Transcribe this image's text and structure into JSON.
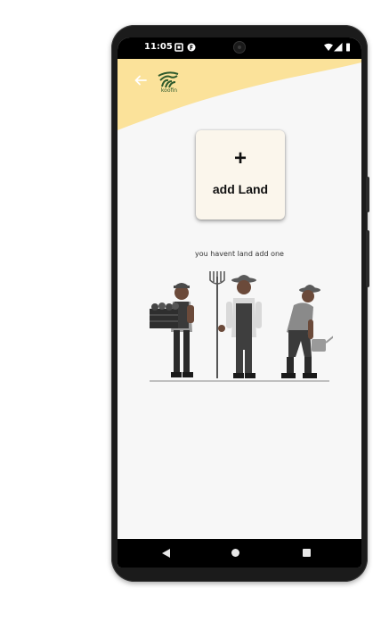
{
  "status_bar": {
    "time": "11:05",
    "icons": [
      "notification-square-icon",
      "app-status-icon",
      "wifi-icon",
      "cell-signal-icon",
      "battery-icon"
    ]
  },
  "header": {
    "back_icon": "arrow-left-icon",
    "logo_text": "koofin",
    "accent_color": "#fbe29a",
    "logo_color": "#2e5a2c"
  },
  "main": {
    "add_button": {
      "icon": "+",
      "label": "add Land"
    },
    "empty_message": "you havent land add one",
    "illustration": "farmers-illustration"
  },
  "nav_bar": {
    "items": [
      "back-triangle-icon",
      "home-circle-icon",
      "recents-square-icon"
    ]
  },
  "colors": {
    "screen_bg": "#f7f7f7",
    "card_bg": "#fbf6ec",
    "bars": "#000000"
  }
}
